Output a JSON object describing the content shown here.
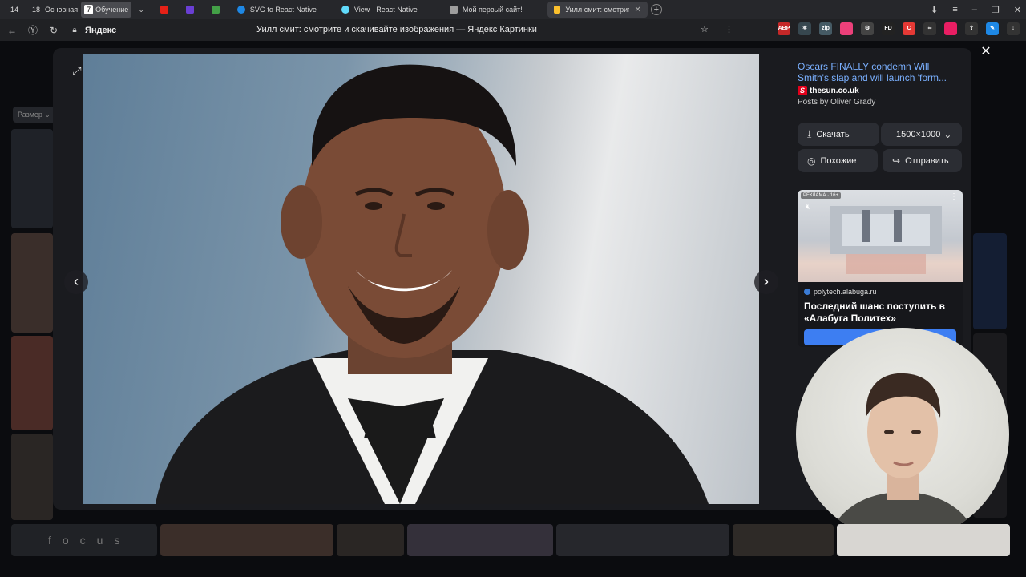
{
  "tabbar": {
    "groups": [
      {
        "num": "14",
        "label": ""
      },
      {
        "num": "18",
        "label": "Основная"
      },
      {
        "num": "7",
        "label": "Обучение"
      }
    ],
    "tabs": [
      {
        "label": "",
        "favicon_color": "#e62117"
      },
      {
        "label": "",
        "favicon_color": "#6a3fd4"
      },
      {
        "label": "",
        "favicon_color": "#43a047"
      },
      {
        "label": "SVG to React Native",
        "favicon_color": "#1e88e5"
      },
      {
        "label": "View · React Native",
        "favicon_color": "#61dafb"
      },
      {
        "label": "Мой первый сайт!",
        "favicon_color": "#9e9e9e"
      },
      {
        "label": "Уилл смит: смотрите и",
        "favicon_color": "#fbc02d",
        "active": true
      }
    ],
    "new_tab": "+",
    "window_controls": [
      "⬇",
      "≡",
      "–",
      "❐",
      "✕"
    ]
  },
  "addressbar": {
    "site": "Яндекс",
    "title": "Уилл смит: смотрите и скачивайте изображения — Яндекс Картинки",
    "extensions": [
      {
        "label": "ABP",
        "color": "#c62828"
      },
      {
        "label": "⚛",
        "color": "#37474f"
      },
      {
        "label": "zip",
        "color": "#455a64"
      },
      {
        "label": "",
        "color": "#ec407a"
      },
      {
        "label": "⚙",
        "color": "#444"
      },
      {
        "label": "FD",
        "color": "#222"
      },
      {
        "label": "C",
        "color": "#e53935"
      },
      {
        "label": "∞",
        "color": "#333"
      },
      {
        "label": "",
        "color": "#e91e63"
      },
      {
        "label": "⇪",
        "color": "#333"
      },
      {
        "label": "✎",
        "color": "#1e88e5"
      },
      {
        "label": "↓",
        "color": "#333"
      }
    ]
  },
  "background": {
    "size_filter": "Размер ⌄"
  },
  "viewer": {
    "expand_icon": "⤢",
    "prev_icon": "‹",
    "next_icon": "›",
    "close_icon": "✕"
  },
  "source": {
    "title": "Oscars FINALLY condemn Will Smith's slap and will launch 'form...",
    "site": "thesun.co.uk",
    "site_logo": "S",
    "author": "Posts by Oliver Grady"
  },
  "actions": {
    "download": "Скачать",
    "resolution": "1500×1000",
    "similar": "Похожие",
    "share": "Отправить"
  },
  "ad": {
    "badge": "РЕКЛАМА · 16+",
    "domain": "polytech.alabuga.ru",
    "title": "Последний шанс поступить в «Алабуга Политех»"
  },
  "bottom_strip": {
    "first_label": "focus"
  },
  "colors": {
    "link": "#7ab0ff",
    "accent": "#3d7ef2",
    "panel": "#1a1b1f"
  }
}
